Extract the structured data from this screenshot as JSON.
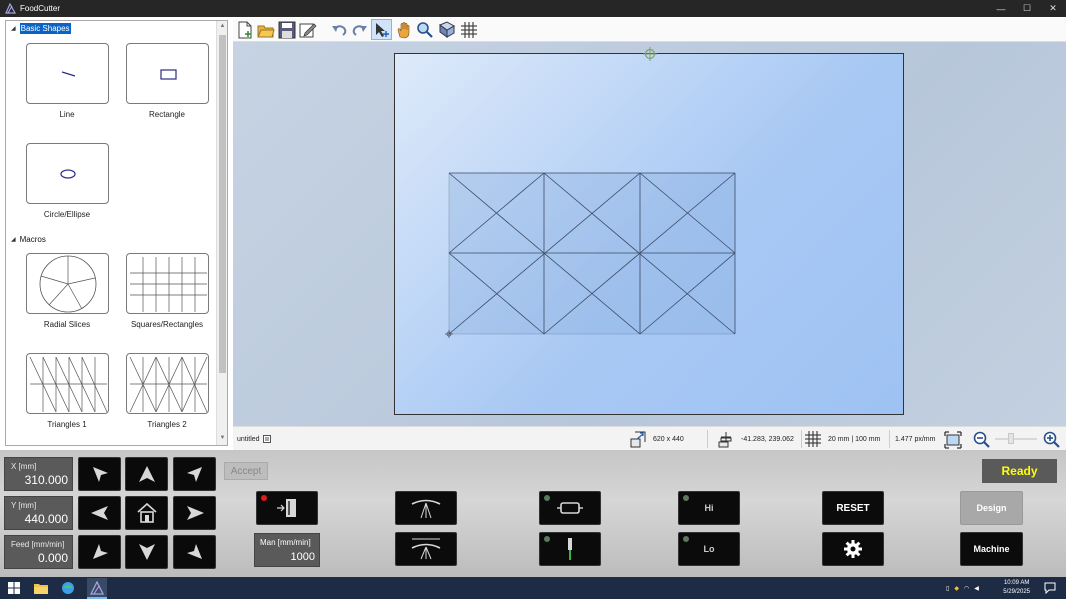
{
  "window": {
    "title": "FoodCutter",
    "minimize_glyph": "—",
    "maximize_glyph": "☐",
    "close_glyph": "✕"
  },
  "palette": {
    "categories": [
      {
        "name": "Basic Shapes",
        "items": [
          {
            "label": "Line",
            "icon": "line-icon"
          },
          {
            "label": "Rectangle",
            "icon": "rectangle-icon"
          },
          {
            "label": "Circle/Ellipse",
            "icon": "ellipse-icon"
          }
        ]
      },
      {
        "name": "Macros",
        "items": [
          {
            "label": "Radial Slices",
            "icon": "radial-slices-icon"
          },
          {
            "label": "Squares/Rectangles",
            "icon": "grid-icon"
          },
          {
            "label": "Triangles 1",
            "icon": "triangles-1-icon"
          },
          {
            "label": "Triangles 2",
            "icon": "triangles-2-icon"
          }
        ]
      }
    ]
  },
  "toolbar": {
    "tools": [
      "new-file-icon",
      "open-folder-icon",
      "save-icon",
      "edit-icon",
      "undo-icon",
      "redo-icon",
      "select-icon",
      "pan-hand-icon",
      "zoom-icon",
      "measure-icon",
      "grid-icon"
    ],
    "active_tool": "select-icon"
  },
  "status": {
    "filename": "untitled",
    "size": "620 x 440",
    "coordinates": "-41.283, 239.062",
    "grid": "20 mm | 100 mm",
    "scale": "1.477 px/mm"
  },
  "controls": {
    "x_label": "X [mm]",
    "x_value": "310.000",
    "y_label": "Y [mm]",
    "y_value": "440.000",
    "feed_label": "Feed [mm/min]",
    "feed_value": "0.000",
    "accept_label": "Accept",
    "man_label": "Man [mm/min]",
    "man_value": "1000",
    "hi_label": "Hi",
    "lo_label": "Lo",
    "reset_label": "RESET",
    "design_label": "Design",
    "machine_label": "Machine",
    "ready_label": "Ready"
  },
  "taskbar": {
    "time": "10:09 AM",
    "date": "5/29/2025"
  },
  "colors": {
    "ready_text": "#ffff00",
    "selection": "#0a64c8",
    "led_red": "#e21a1a"
  }
}
